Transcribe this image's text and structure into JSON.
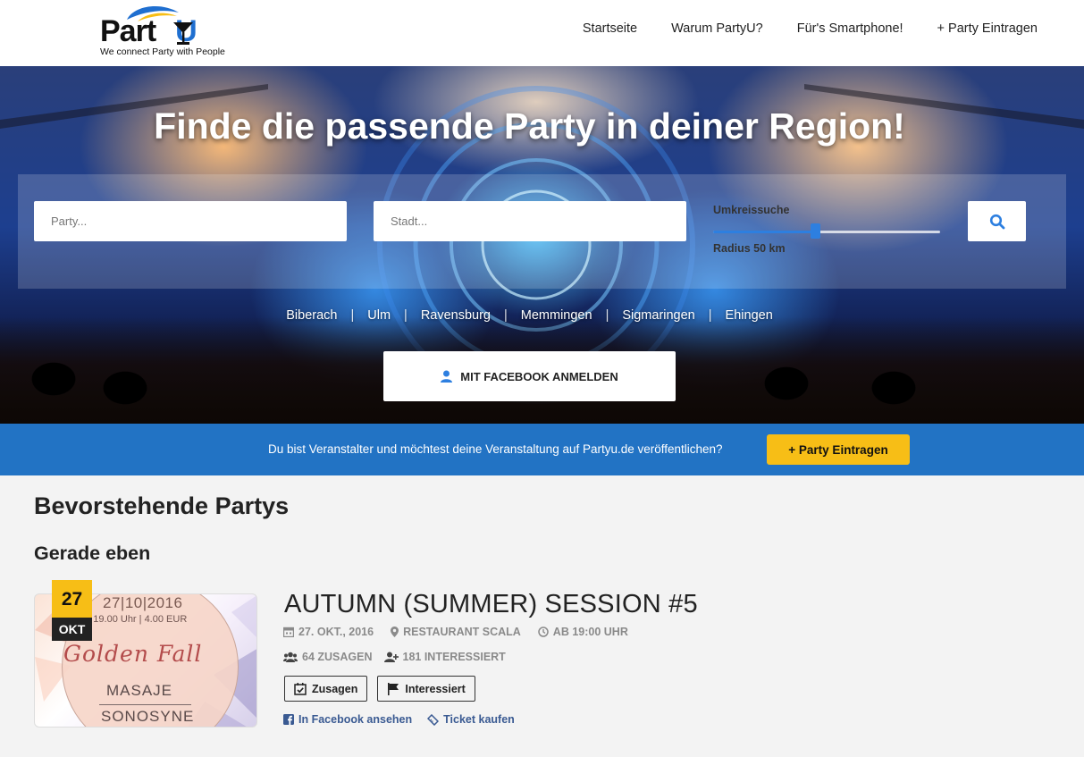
{
  "header": {
    "logo_text_part": "Part",
    "logo_text_u": "U",
    "tagline": "We connect Party with People",
    "nav": [
      {
        "label": "Startseite"
      },
      {
        "label": "Warum PartyU?"
      },
      {
        "label": "Für's Smartphone!"
      },
      {
        "label": "+ Party Eintragen"
      }
    ]
  },
  "hero": {
    "title": "Finde die passende Party in deiner Region!",
    "party_placeholder": "Party...",
    "stadt_placeholder": "Stadt...",
    "radius_label": "Umkreissuche",
    "radius_value": "Radius 50 km",
    "radius_level": 0.45,
    "search_icon": "search-icon",
    "cities": [
      "Biberach",
      "Ulm",
      "Ravensburg",
      "Memmingen",
      "Sigmaringen",
      "Ehingen"
    ],
    "city_separator": "|",
    "facebook_button": "MIT FACEBOOK ANMELDEN"
  },
  "promo": {
    "text": "Du bist Veranstalter und möchtest deine Veranstaltung auf Partyu.de veröffentlichen?",
    "button": "+ Party Eintragen"
  },
  "content": {
    "title": "Bevorstehende Partys",
    "subtitle": "Gerade eben",
    "event": {
      "day": "27",
      "month": "OKT",
      "poster": {
        "date": "27|10|2016",
        "time": "ab 19.00 Uhr | 4.00 EUR",
        "script": "Golden Fall",
        "line1": "MASAJE",
        "line2": "SONOSYNE"
      },
      "title": "AUTUMN (SUMMER) SESSION #5",
      "date": "27. OKT., 2016",
      "location": "RESTAURANT SCALA",
      "time": "AB 19:00 UHR",
      "zusagen": "64 ZUSAGEN",
      "interessiert": "181 INTERESSIERT",
      "btn_zusagen": "Zusagen",
      "btn_interessiert": "Interessiert",
      "link_facebook": "In Facebook ansehen",
      "link_ticket": "Ticket kaufen"
    }
  },
  "colors": {
    "brand_blue": "#2273c4",
    "accent_yellow": "#f7be16",
    "slider_blue": "#2d7fe0",
    "link_blue": "#3a5a92"
  }
}
